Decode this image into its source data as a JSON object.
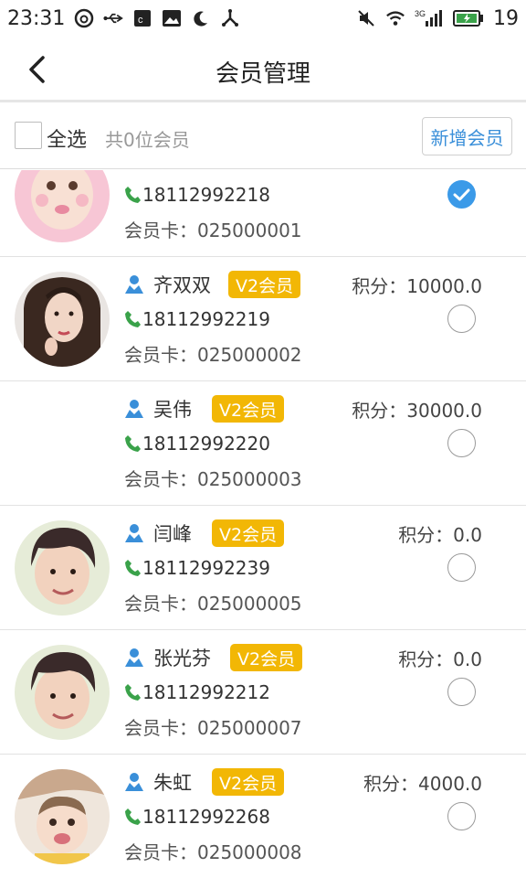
{
  "status_bar": {
    "time": "23:31",
    "battery_level": "19",
    "network_label": "3G"
  },
  "header": {
    "title": "会员管理"
  },
  "toolbar": {
    "select_all_label": "全选",
    "member_count": "共0位会员",
    "add_button": "新增会员"
  },
  "colors": {
    "accent": "#3b9ae8",
    "badge": "#f2b705",
    "phone_icon": "#3aa24a",
    "person_icon": "#3a8fd9"
  },
  "members": [
    {
      "name": "",
      "badge": "",
      "points_label": "",
      "phone": "18112992218",
      "card_label": "会员卡：",
      "card_no": "025000001",
      "selected": true
    },
    {
      "name": "齐双双",
      "badge": "V2会员",
      "points_label": "积分：10000.0",
      "phone": "18112992219",
      "card_label": "会员卡：",
      "card_no": "025000002",
      "selected": false
    },
    {
      "name": "吴伟",
      "badge": "V2会员",
      "points_label": "积分：30000.0",
      "phone": "18112992220",
      "card_label": "会员卡：",
      "card_no": "025000003",
      "selected": false
    },
    {
      "name": "闫峰",
      "badge": "V2会员",
      "points_label": "积分：0.0",
      "phone": "18112992239",
      "card_label": "会员卡：",
      "card_no": "025000005",
      "selected": false
    },
    {
      "name": "张光芬",
      "badge": "V2会员",
      "points_label": "积分：0.0",
      "phone": "18112992212",
      "card_label": "会员卡：",
      "card_no": "025000007",
      "selected": false
    },
    {
      "name": "朱虹",
      "badge": "V2会员",
      "points_label": "积分：4000.0",
      "phone": "18112992268",
      "card_label": "会员卡：",
      "card_no": "025000008",
      "selected": false
    }
  ]
}
